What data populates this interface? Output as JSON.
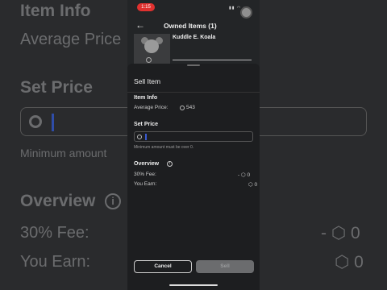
{
  "background": {
    "item_info": "Item Info",
    "average_price": "Average Price",
    "set_price": "Set Price",
    "minimum": "Minimum amount",
    "overview": "Overview",
    "fee": "30% Fee:",
    "you_earn": "You Earn:",
    "fee_value": "- ⬡ 0",
    "earn_value": "⬡ 0"
  },
  "status": {
    "time": "1:15"
  },
  "header": {
    "back_icon": "back-arrow-icon",
    "title": "Owned Items (1)"
  },
  "item": {
    "name": "Kuddle E. Koala"
  },
  "sheet": {
    "title": "Sell Item",
    "item_info_label": "Item Info",
    "average_price_label": "Average Price:",
    "average_price_value": "543",
    "set_price_label": "Set Price",
    "price_input_value": "",
    "min_note": "Minimum amount must be over 0.",
    "overview_label": "Overview",
    "fee_label": "30% Fee:",
    "fee_value": "- ⬡ 0",
    "earn_label": "You Earn:",
    "earn_value": "⬡ 0",
    "cancel_label": "Cancel",
    "sell_label": "Sell"
  },
  "colors": {
    "accent": "#3a5bd0",
    "status_pill": "#e0312f",
    "sheet_bg": "#1d1e20"
  }
}
